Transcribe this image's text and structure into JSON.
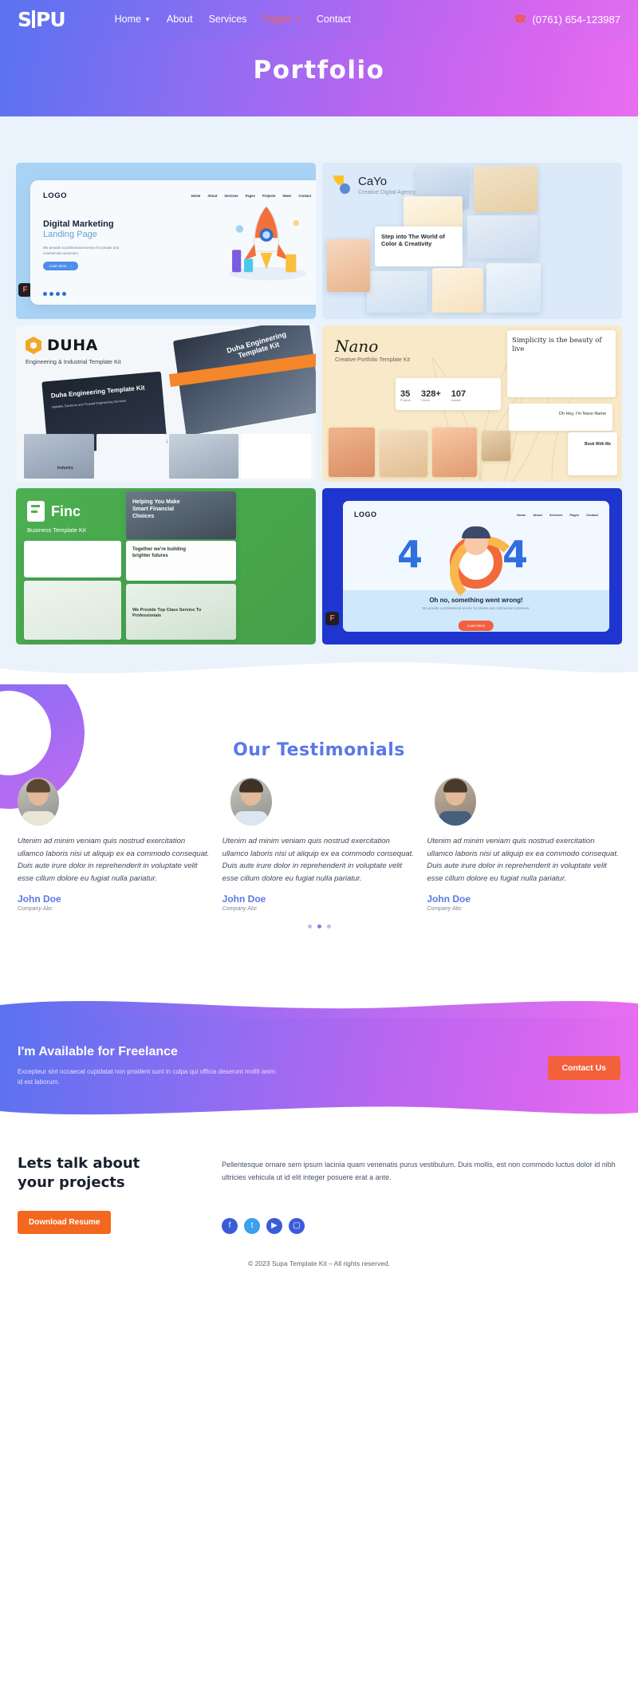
{
  "header": {
    "logo": "SIPU",
    "nav": [
      {
        "label": "Home",
        "has_caret": true,
        "active": false
      },
      {
        "label": "About",
        "has_caret": false,
        "active": false
      },
      {
        "label": "Services",
        "has_caret": false,
        "active": false
      },
      {
        "label": "Pages",
        "has_caret": true,
        "active": true
      },
      {
        "label": "Contact",
        "has_caret": false,
        "active": false
      }
    ],
    "phone": "(0761) 654-123987",
    "phone_icon": "phone-icon",
    "accent": "#f0654a"
  },
  "hero": {
    "title": "Portfolio"
  },
  "portfolio": {
    "cards": [
      {
        "name": "digital-marketing",
        "logo": "LOGO",
        "nav": [
          "Home",
          "About",
          "Services",
          "Pages",
          "Projects",
          "News",
          "Contact"
        ],
        "title": "Digital Marketing",
        "subtitle": "Landing Page",
        "body": "We provide a professional service for private and commercial customers.",
        "button": "Learn More",
        "badge": "figma-icon"
      },
      {
        "name": "cayo",
        "title": "CaYo",
        "subtitle": "Creative Digital Agency",
        "headline": "Step into The World of Color & Creativity"
      },
      {
        "name": "duha",
        "title": "DUHA",
        "subtitle": "Engineering & Industrial Template Kit",
        "overlay": "Duha Engineering Template Kit",
        "panel_title": "Duha Engineering Template Kit",
        "panel_sub": "Reliable Solutions and Trusted Engineering Services",
        "tag": "Industry"
      },
      {
        "name": "nano",
        "title": "Nano",
        "subtitle": "Creative Portfolio Template Kit",
        "quote": "Simplicity is the beauty of live",
        "stats": [
          {
            "value": "35",
            "label": "Projects"
          },
          {
            "value": "328+",
            "label": "Clients"
          },
          {
            "value": "107",
            "label": "Awards"
          }
        ],
        "note": "Oh Hey, I'm Nano Name",
        "cta": "Book With Me"
      },
      {
        "name": "finc",
        "title": "Finc",
        "subtitle": "Business Template Kit",
        "headline": "Helping You Make Smart Financial Choices",
        "sub2": "Together we're building brighter futures",
        "sub3": "We Provide Top Class Service To Professionals"
      },
      {
        "name": "error-404",
        "logo": "LOGO",
        "nav": [
          "Home",
          "About",
          "Services",
          "Pages",
          "Contact"
        ],
        "code": "404",
        "code_left": "4",
        "code_right": "4",
        "title": "Oh no, something went wrong!",
        "body": "We provide a professional service for private and commercial customers.",
        "button": "Learn More"
      }
    ]
  },
  "testimonials": {
    "title": "Our Testimonials",
    "items": [
      {
        "quote": "Utenim ad minim veniam quis nostrud exercitation ullamco laboris nisi ut aliquip ex ea commodo consequat. Duis aute irure dolor in reprehenderit in voluptate velit esse cillum dolore eu fugiat nulla pariatur.",
        "name": "John Doe",
        "company": "Company Abc"
      },
      {
        "quote": "Utenim ad minim veniam quis nostrud exercitation ullamco laboris nisi ut aliquip ex ea commodo consequat. Duis aute irure dolor in reprehenderit in voluptate velit esse cillum dolore eu fugiat nulla pariatur.",
        "name": "John Doe",
        "company": "Company Abc"
      },
      {
        "quote": "Utenim ad minim veniam quis nostrud exercitation ullamco laboris nisi ut aliquip ex ea commodo consequat. Duis aute irure dolor in reprehenderit in voluptate velit esse cillum dolore eu fugiat nulla pariatur.",
        "name": "John Doe",
        "company": "Company Abc"
      }
    ],
    "pager_count": 3,
    "pager_active": 1,
    "title_color": "#5a78e8"
  },
  "freelance": {
    "title": "I'm Available for Freelance",
    "body": "Excepteur sint occaecat cupidatat non proident sunt in culpa qui officia deserunt mollit anim id est laborum.",
    "button": "Contact Us",
    "button_color": "#f4603c"
  },
  "footer": {
    "heading_line1": "Lets talk about",
    "heading_line2": "your projects",
    "resume_button": "Download Resume",
    "resume_color": "#f4671f",
    "paragraph": "Pellentesque ornare sem ipsum lacinia quam venenatis purus vestibulum. Duis mollis, est non commodo luctus dolor id nibh ultricies vehicula ut id elit integer posuere erat a ante.",
    "socials": [
      {
        "name": "facebook-icon",
        "glyph": "f"
      },
      {
        "name": "twitter-icon",
        "glyph": "t"
      },
      {
        "name": "youtube-icon",
        "glyph": "▶"
      },
      {
        "name": "instagram-icon",
        "glyph": "▢"
      }
    ],
    "copyright": "© 2023 Supa Template Kit – All rights reserved."
  }
}
